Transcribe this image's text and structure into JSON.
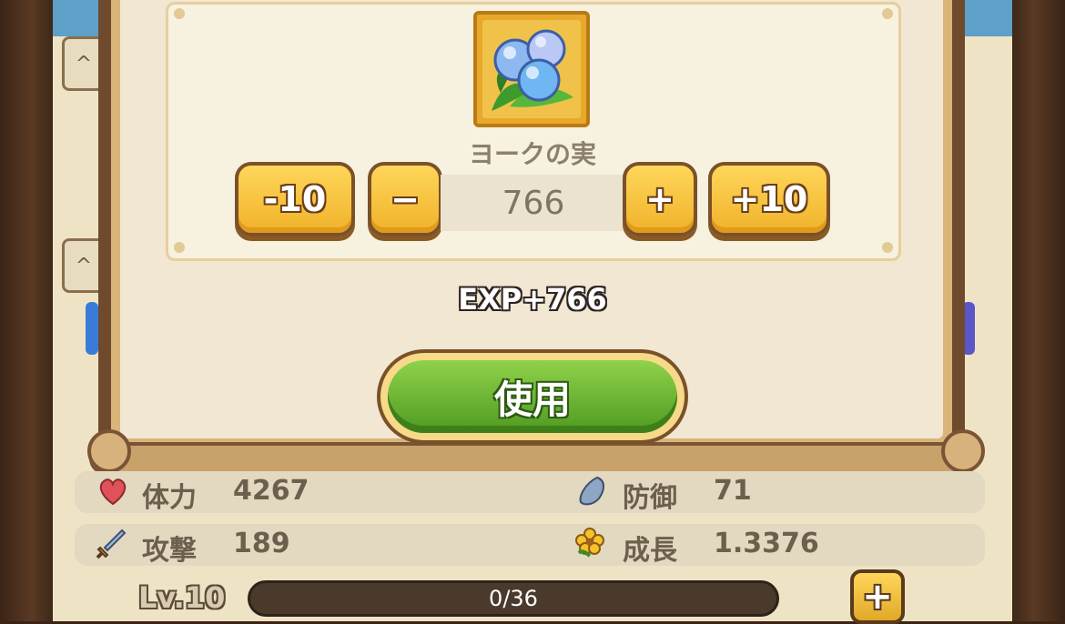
{
  "dialog": {
    "item_name": "ヨークの実",
    "icon": "berry-icon",
    "buttons": {
      "minus_ten": "-10",
      "minus": "−",
      "plus": "+",
      "plus_ten": "+10"
    },
    "quantity": "766",
    "exp_gain": "EXP+766",
    "use_label": "使用"
  },
  "stats": {
    "hp_label": "体力",
    "hp_value": "4267",
    "def_label": "防御",
    "def_value": "71",
    "atk_label": "攻撃",
    "atk_value": "189",
    "growth_label": "成長",
    "growth_value": "1.3376"
  },
  "level": {
    "label": "Lv.10",
    "exp_text": "0/36",
    "progress": 0,
    "plus_label": "+"
  },
  "background": {
    "tab_glyph": "^"
  },
  "colors": {
    "accent_gold": "#f0b22a",
    "use_green": "#6ab832",
    "frame_brown": "#6f4a2c"
  }
}
